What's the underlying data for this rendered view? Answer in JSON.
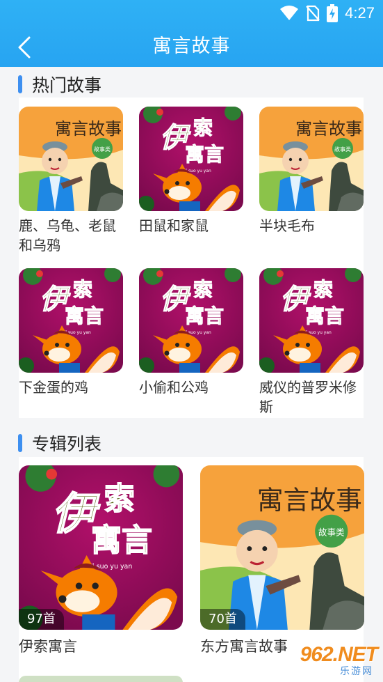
{
  "status": {
    "time": "4:27"
  },
  "header": {
    "title": "寓言故事"
  },
  "hot": {
    "title": "热门故事",
    "items": [
      {
        "title": "鹿、乌龟、老鼠和乌鸦",
        "cover": "dongfang"
      },
      {
        "title": "田鼠和家鼠",
        "cover": "yisuo"
      },
      {
        "title": "半块毛布",
        "cover": "dongfang"
      },
      {
        "title": "下金蛋的鸡",
        "cover": "yisuo"
      },
      {
        "title": "小偷和公鸡",
        "cover": "yisuo"
      },
      {
        "title": "威仪的普罗米修斯",
        "cover": "yisuo"
      }
    ]
  },
  "albums": {
    "title": "专辑列表",
    "items": [
      {
        "title": "伊索寓言",
        "count": "97首",
        "cover": "yisuo"
      },
      {
        "title": "东方寓言故事",
        "count": "70首",
        "cover": "dongfang"
      }
    ]
  },
  "covers": {
    "yisuo": {
      "title_line1": "伊索",
      "title_line2": "寓言",
      "sub": "Yi suo yu yan",
      "bg": "#b2106a",
      "bg2": "#7c0a4e"
    },
    "dongfang": {
      "title": "寓言故事",
      "badge": "故事类",
      "bg": "#f6a23c",
      "bg2": "#fde7b4"
    }
  },
  "watermark": {
    "main": "962.NET",
    "sub": "乐游网"
  },
  "colors": {
    "header": "#2aa8f2",
    "accent": "#3d8ff0"
  }
}
